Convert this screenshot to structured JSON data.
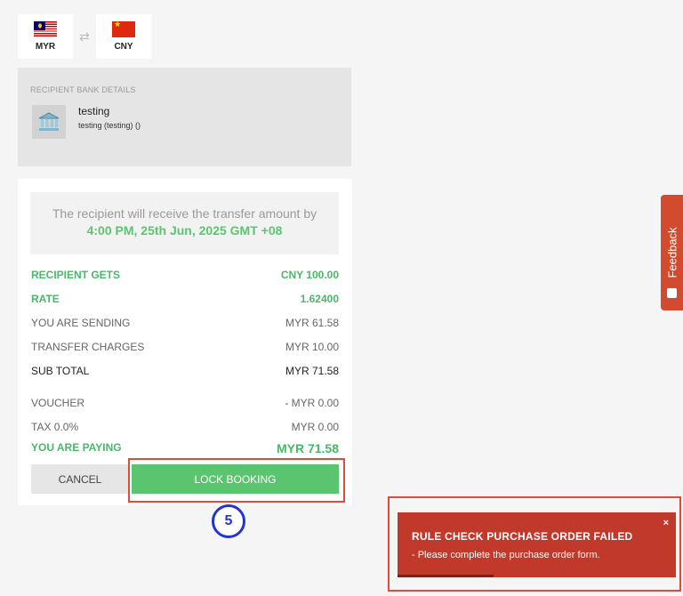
{
  "currency": {
    "from": {
      "code": "MYR",
      "flag": "malaysia-flag"
    },
    "to": {
      "code": "CNY",
      "flag": "china-flag"
    },
    "swap_icon": "swap-arrows-icon"
  },
  "recipient": {
    "heading": "RECIPIENT BANK DETAILS",
    "icon": "bank-icon",
    "name": "testing",
    "details": "testing  (testing)  ()"
  },
  "summary": {
    "notice_line1": "The recipient will receive the transfer amount by",
    "notice_line2": "4:00 PM, 25th Jun, 2025 GMT +08",
    "rows": [
      {
        "label": "RECIPIENT GETS",
        "value": "CNY 100.00"
      },
      {
        "label": "RATE",
        "value": "1.62400"
      },
      {
        "label": "YOU ARE SENDING",
        "value": "MYR 61.58"
      },
      {
        "label": "TRANSFER CHARGES",
        "value": "MYR 10.00"
      },
      {
        "label": "SUB TOTAL",
        "value": "MYR 71.58"
      },
      {
        "label": "VOUCHER",
        "value": "- MYR 0.00"
      },
      {
        "label": "TAX 0.0%",
        "value": "MYR 0.00"
      },
      {
        "label": "YOU ARE PAYING",
        "value": "MYR 71.58"
      }
    ],
    "cancel_label": "CANCEL",
    "lock_label": "LOCK BOOKING"
  },
  "annotation": {
    "step_number": "5"
  },
  "feedback": {
    "label": "Feedback"
  },
  "toast": {
    "title": "RULE CHECK PURCHASE ORDER FAILED",
    "message": "- Please complete the purchase order form.",
    "close": "×"
  },
  "colors": {
    "accent_green": "#5bc46e",
    "error_red": "#c0392b",
    "annotation_blue": "#2333d6"
  }
}
